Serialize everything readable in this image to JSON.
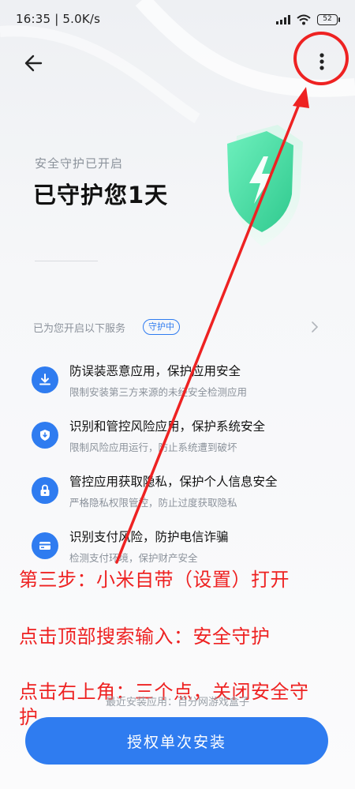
{
  "status_bar": {
    "time": "16:35 | 5.0K/s",
    "battery": "52"
  },
  "header": {
    "back_icon": "arrow-left-icon",
    "more_icon": "more-vertical-icon"
  },
  "protection": {
    "subtitle": "安全守护已开启",
    "title": "已守护您1天"
  },
  "services": {
    "label": "已为您开启以下服务",
    "badge": "守护中",
    "items": [
      {
        "icon": "download-shield-icon",
        "title": "防误装恶意应用，保护应用安全",
        "desc": "限制安装第三方来源的未经安全检测应用"
      },
      {
        "icon": "shield-icon",
        "title": "识别和管控风险应用，保护系统安全",
        "desc": "限制风险应用运行，防止系统遭到破坏"
      },
      {
        "icon": "lock-icon",
        "title": "管控应用获取隐私，保护个人信息安全",
        "desc": "严格隐私权限管控，防止过度获取隐私"
      },
      {
        "icon": "card-icon",
        "title": "识别支付风险，防护电信诈骗",
        "desc": "检测支付环境，保护财产安全"
      }
    ]
  },
  "annotations": {
    "step3": "第三步：小米自带（设置）打开",
    "search": "点击顶部搜索输入：安全守护",
    "close_line1": "点击右上角：三个点，关闭安全守",
    "close_line2": "护"
  },
  "footer": {
    "recent_install": "最近安装应用：百分网游戏盒子",
    "authorize_button": "授权单次安装"
  },
  "colors": {
    "accent": "#2f7cf0",
    "annotation_red": "#ee2222",
    "shield_green": "#3ddba0"
  }
}
